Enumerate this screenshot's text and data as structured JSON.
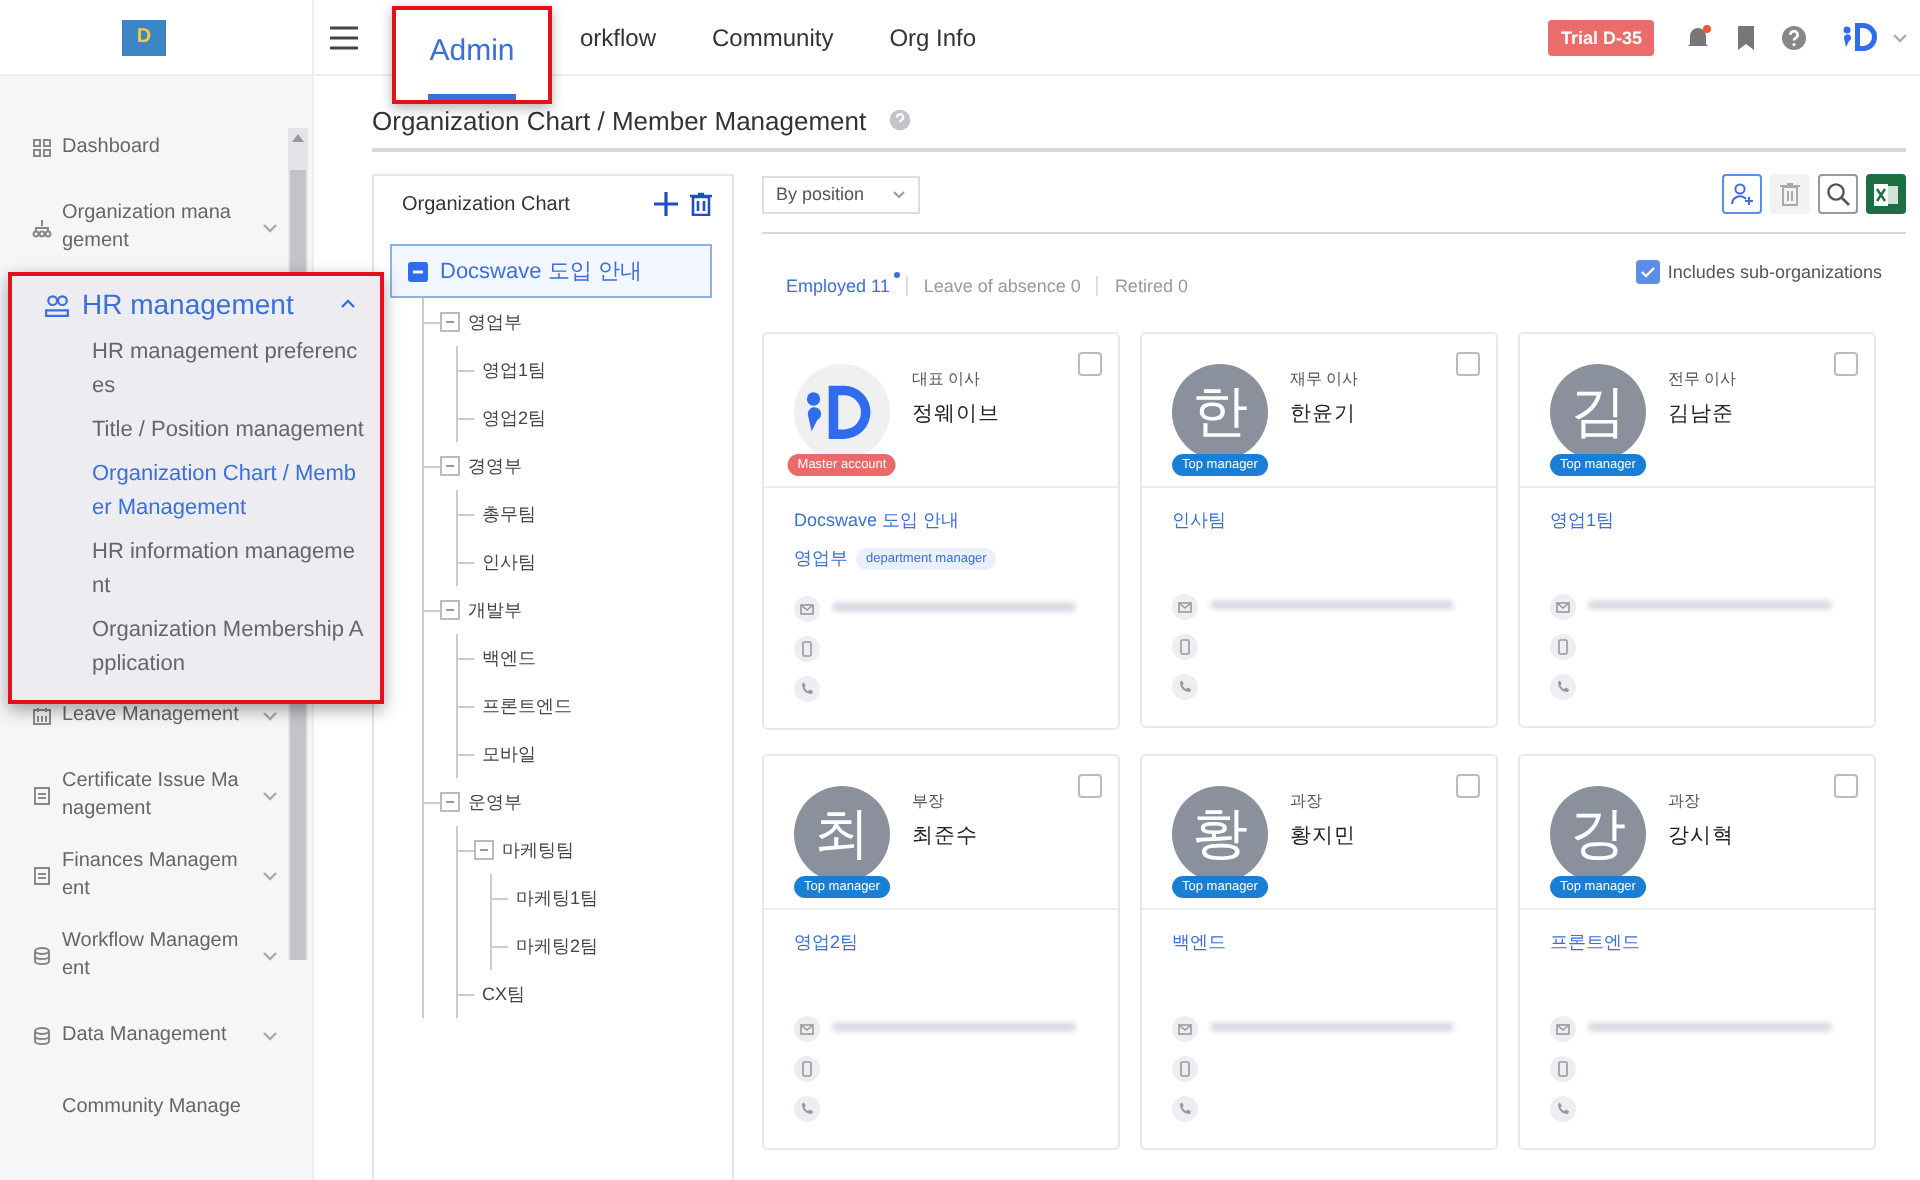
{
  "logo_letter": "D",
  "sidebar": {
    "items": [
      {
        "label": "Dashboard",
        "expandable": false
      },
      {
        "label": "Organization management",
        "expandable": true
      },
      {
        "label": "HR management",
        "expandable": true,
        "expanded": true,
        "children": [
          {
            "label": "HR management preferences",
            "selected": false
          },
          {
            "label": "Title / Position management",
            "selected": false
          },
          {
            "label": "Organization Chart / Member Management",
            "selected": true
          },
          {
            "label": "HR information management",
            "selected": false
          },
          {
            "label": "Organization Membership Application",
            "selected": false
          }
        ]
      },
      {
        "label": "Leave Management",
        "expandable": true
      },
      {
        "label": "Certificate Issue Management",
        "expandable": true
      },
      {
        "label": "Finances Management",
        "expandable": true
      },
      {
        "label": "Workflow Management",
        "expandable": true
      },
      {
        "label": "Data Management",
        "expandable": true
      },
      {
        "label": "Community Manage",
        "expandable": false
      }
    ]
  },
  "tabs": [
    {
      "label": "Admin",
      "selected": true
    },
    {
      "label": "orkflow",
      "selected": false
    },
    {
      "label": "Community",
      "selected": false
    },
    {
      "label": "Org Info",
      "selected": false
    }
  ],
  "trial_badge": "Trial D-35",
  "notifications_unread": true,
  "page_title": "Organization Chart / Member Management",
  "org_panel": {
    "title": "Organization Chart",
    "tree": [
      {
        "label": "Docswave 도입 안내",
        "selected": true,
        "expanded": true,
        "children": [
          {
            "label": "영업부",
            "expanded": true,
            "children": [
              {
                "label": "영업1팀"
              },
              {
                "label": "영업2팀"
              }
            ]
          },
          {
            "label": "경영부",
            "expanded": true,
            "children": [
              {
                "label": "총무팀"
              },
              {
                "label": "인사팀"
              }
            ]
          },
          {
            "label": "개발부",
            "expanded": true,
            "children": [
              {
                "label": "백엔드"
              },
              {
                "label": "프론트엔드"
              },
              {
                "label": "모바일"
              }
            ]
          },
          {
            "label": "운영부",
            "expanded": true,
            "children": [
              {
                "label": "마케팅팀",
                "expanded": true,
                "children": [
                  {
                    "label": "마케팅1팀"
                  },
                  {
                    "label": "마케팅2팀"
                  }
                ]
              },
              {
                "label": "CX팀"
              }
            ]
          }
        ]
      }
    ]
  },
  "sort_select": "By position",
  "status_tabs": [
    {
      "label": "Employed 11",
      "selected": true,
      "new": true
    },
    {
      "label": "Leave of absence 0",
      "selected": false,
      "new": false
    },
    {
      "label": "Retired 0",
      "selected": false,
      "new": false
    }
  ],
  "include_sub_orgs": {
    "label": "Includes sub-organizations",
    "checked": true
  },
  "members": [
    {
      "kind": "logo",
      "title": "대표 이사",
      "name": "정웨이브",
      "badge": {
        "text": "Master account",
        "color": "#e86a6a"
      },
      "org": "Docswave 도입 안내",
      "dept": "영업부",
      "dept_tag": "department manager",
      "checked": false
    },
    {
      "kind": "initial",
      "initial": "한",
      "title": "재무 이사",
      "name": "한윤기",
      "badge": {
        "text": "Top manager",
        "color": "#1a7fd4"
      },
      "org": "인사팀",
      "checked": false
    },
    {
      "kind": "initial",
      "initial": "김",
      "title": "전무 이사",
      "name": "김남준",
      "badge": {
        "text": "Top manager",
        "color": "#1a7fd4"
      },
      "org": "영업1팀",
      "checked": false
    },
    {
      "kind": "initial",
      "initial": "최",
      "title": "부장",
      "name": "최준수",
      "badge": {
        "text": "Top manager",
        "color": "#1a7fd4"
      },
      "org": "영업2팀",
      "checked": false
    },
    {
      "kind": "initial",
      "initial": "황",
      "title": "과장",
      "name": "황지민",
      "badge": {
        "text": "Top manager",
        "color": "#1a7fd4"
      },
      "org": "백엔드",
      "checked": false
    },
    {
      "kind": "initial",
      "initial": "강",
      "title": "과장",
      "name": "강시혁",
      "badge": {
        "text": "Top manager",
        "color": "#1a7fd4"
      },
      "org": "프론트엔드",
      "checked": false
    }
  ]
}
